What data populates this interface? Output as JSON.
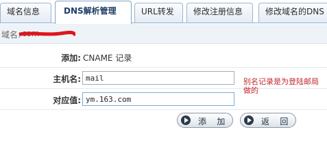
{
  "tabs": [
    {
      "label": "域名信息"
    },
    {
      "label": "DNS解析管理",
      "active": true
    },
    {
      "label": "URL转发"
    },
    {
      "label": "修改注册信息"
    },
    {
      "label": "修改域名的DNS"
    }
  ],
  "domain": {
    "label": "域名:",
    "value": "                .com"
  },
  "form": {
    "add_label": "添加:",
    "add_value": "CNAME 记录",
    "host_label": "主机名:",
    "host_value": "mail",
    "target_label": "对应值:",
    "target_value": "ym.163.com"
  },
  "note": "别名记录是为登陆邮局做的",
  "buttons": {
    "add": "添 加",
    "back": "返 回"
  },
  "colors": {
    "accent": "#1f3f66",
    "note": "#c1272d",
    "redaction": "#e0151b"
  }
}
